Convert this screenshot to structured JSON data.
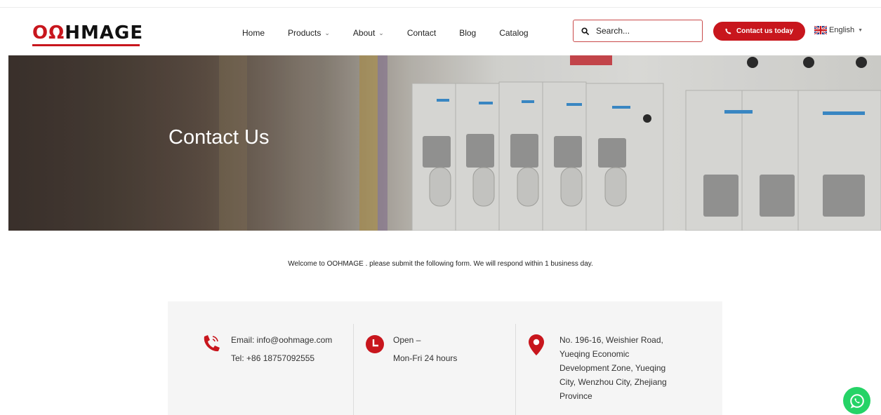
{
  "brand": {
    "logo_text_a": "O",
    "logo_text_b": "Ω",
    "logo_text_c": "HMAGE",
    "accent_color": "#c8161d"
  },
  "nav": {
    "items": [
      {
        "label": "Home",
        "has_dropdown": false
      },
      {
        "label": "Products",
        "has_dropdown": true
      },
      {
        "label": "About",
        "has_dropdown": true
      },
      {
        "label": "Contact",
        "has_dropdown": false
      },
      {
        "label": "Blog",
        "has_dropdown": false
      },
      {
        "label": "Catalog",
        "has_dropdown": false
      }
    ]
  },
  "search": {
    "placeholder": "Search...",
    "icon": "search-icon"
  },
  "cta": {
    "label": "Contact us today",
    "icon": "phone-icon"
  },
  "language": {
    "label": "English",
    "flag": "uk-flag-icon"
  },
  "hero": {
    "title": "Contact Us"
  },
  "welcome": "Welcome to OOHMAGE . please submit the following form. We will respond within 1 business day.",
  "contact": {
    "email_line": "Email: info@oohmage.com",
    "tel_line": "Tel: +86 18757092555",
    "hours_line1": "Open –",
    "hours_line2": "Mon-Fri 24 hours",
    "address_lines": [
      "No. 196-16, Weishier Road,",
      "Yueqing Economic",
      "Development Zone, Yueqing",
      "City, Wenzhou City, Zhejiang",
      "Province"
    ]
  },
  "whatsapp": {
    "icon": "whatsapp-icon",
    "color": "#25d366"
  }
}
